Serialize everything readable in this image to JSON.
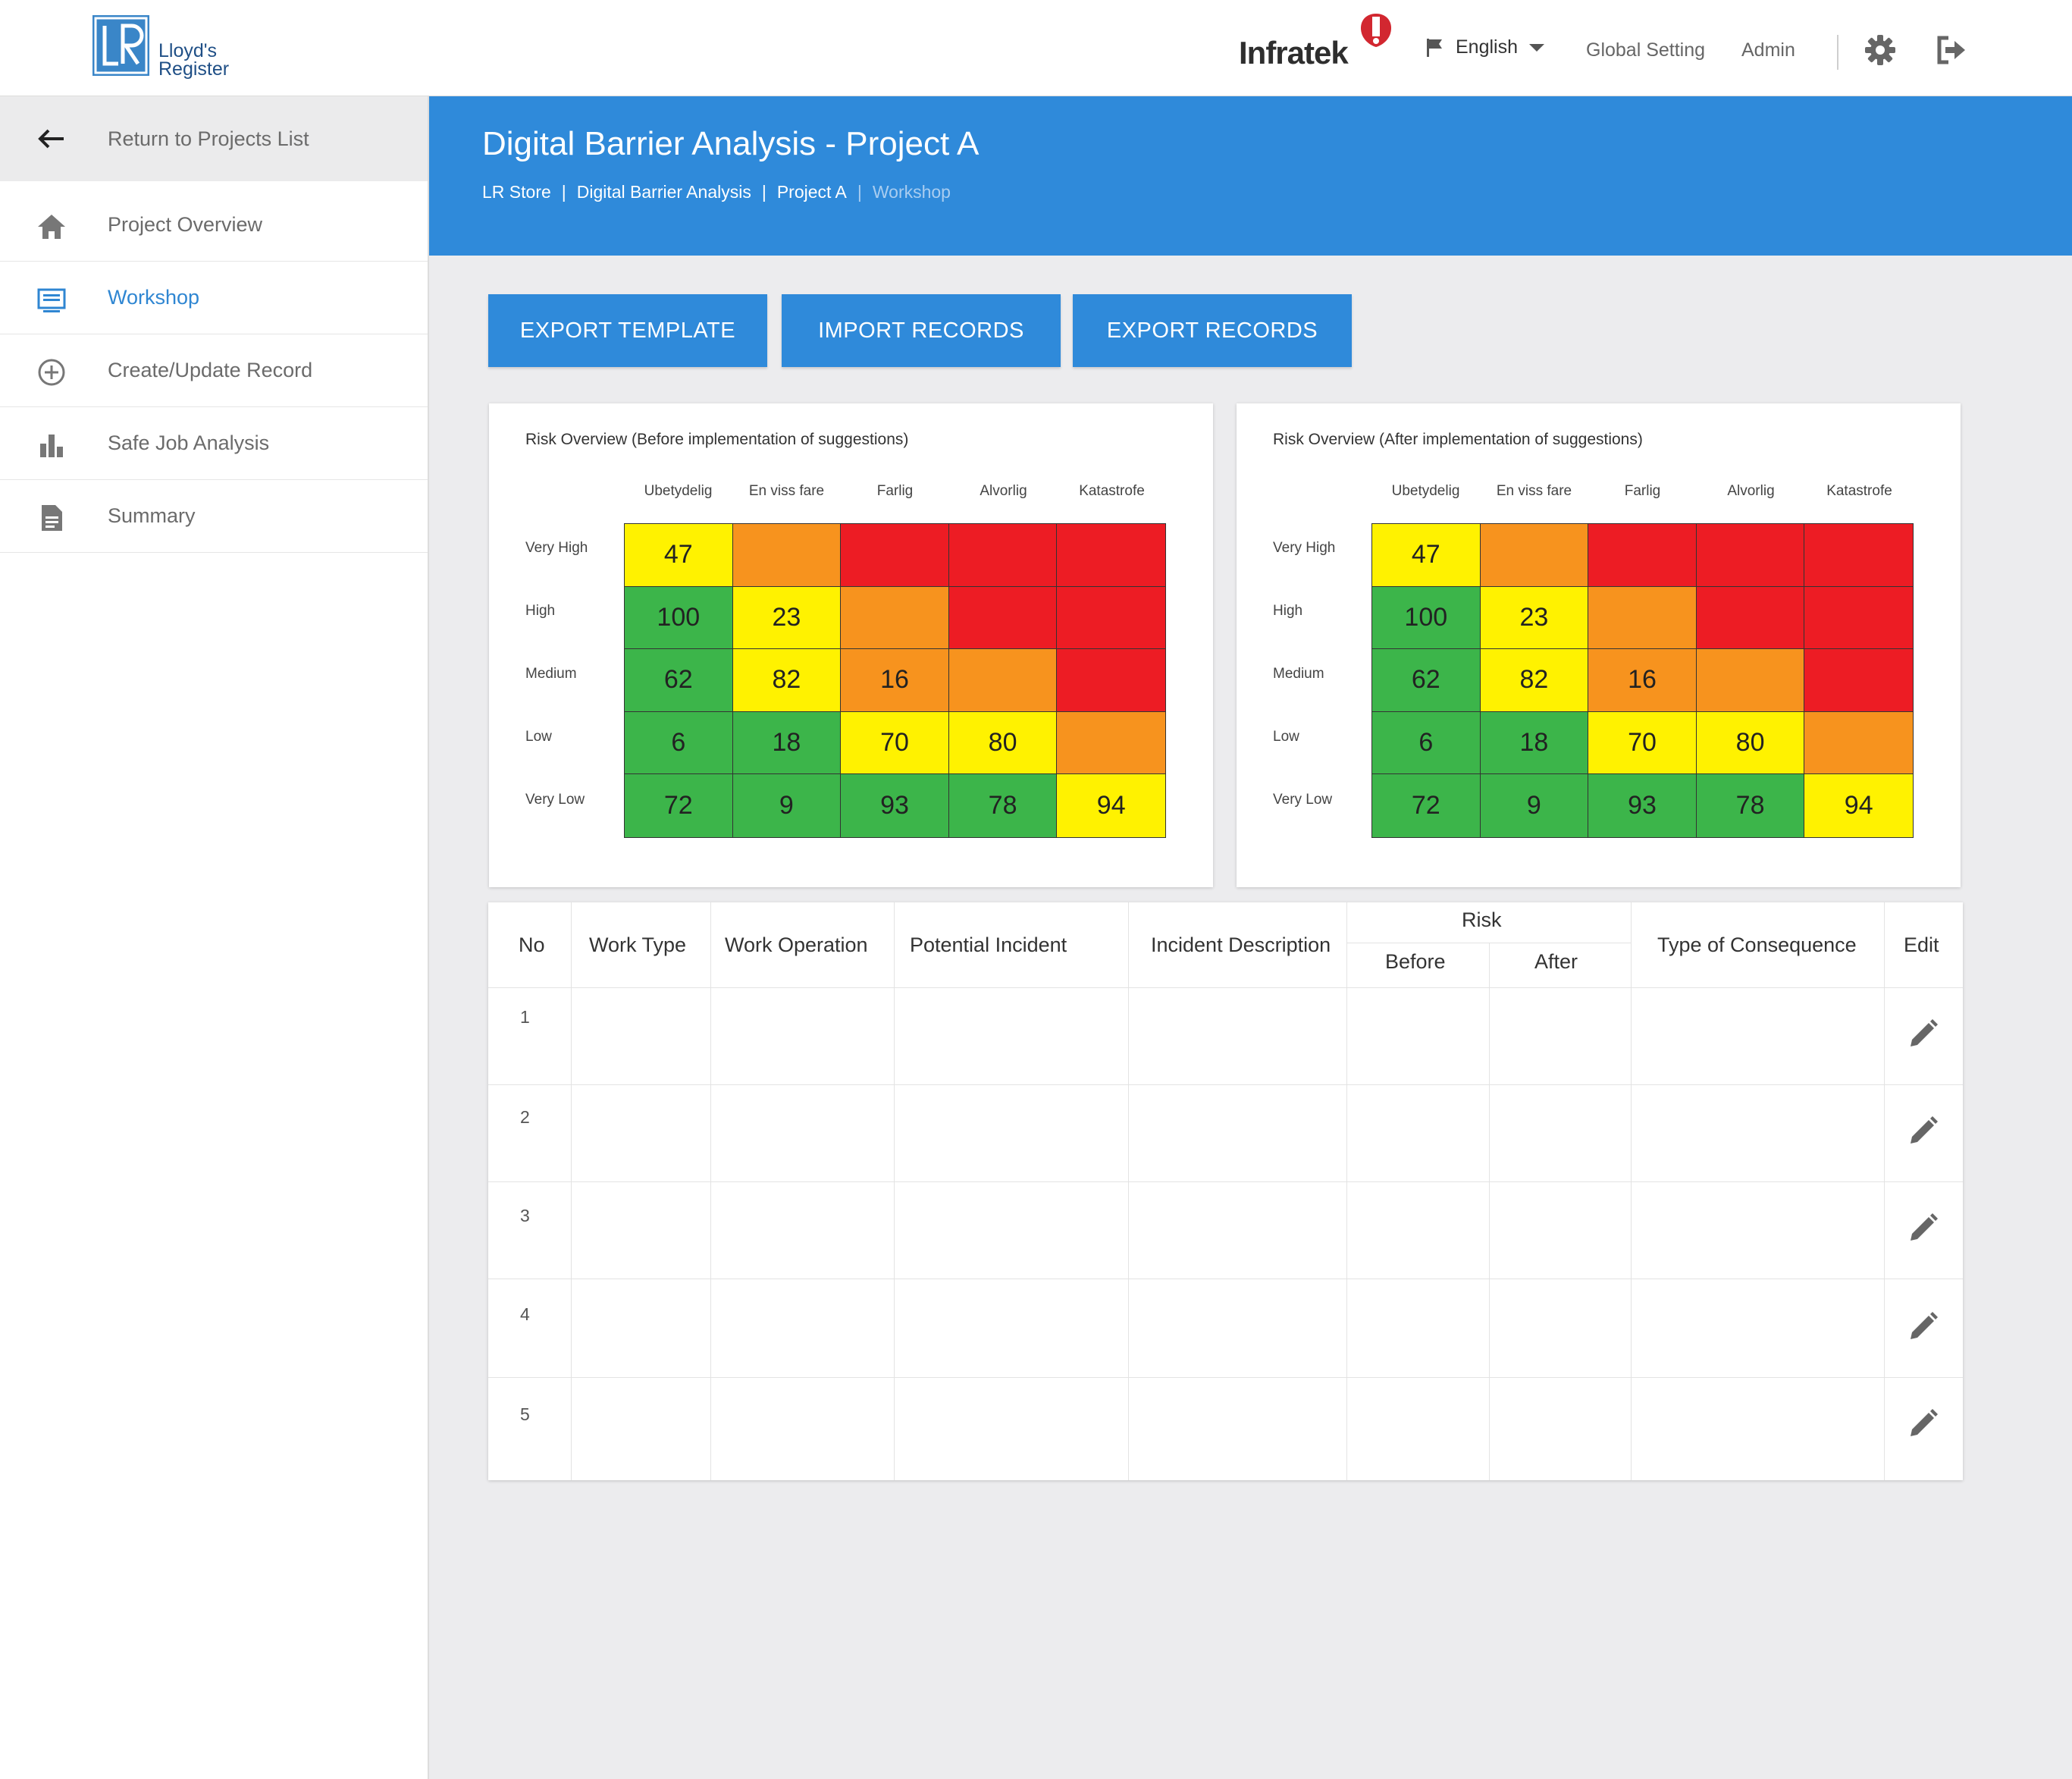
{
  "topbar": {
    "brand_line1": "Lloyd's",
    "brand_line2": "Register",
    "brand_logo_letters": "LR",
    "partner_brand": "Infratek",
    "language": "English",
    "global_setting": "Global Setting",
    "admin": "Admin",
    "icons": [
      "flag-icon",
      "chevron-down-icon",
      "gear-icon",
      "logout-icon"
    ]
  },
  "sidebar": {
    "return_label": "Return to Projects List",
    "items": [
      {
        "label": "Project Overview",
        "icon": "home-icon"
      },
      {
        "label": "Workshop",
        "icon": "monitor-icon",
        "active": true
      },
      {
        "label": "Create/Update Record",
        "icon": "plus-circle-icon"
      },
      {
        "label": "Safe Job Analysis",
        "icon": "bar-chart-icon"
      },
      {
        "label": "Summary",
        "icon": "document-icon"
      }
    ]
  },
  "header": {
    "title": "Digital Barrier Analysis - Project A",
    "breadcrumb": [
      "LR Store",
      "Digital Barrier Analysis",
      "Project  A",
      "Workshop"
    ]
  },
  "actions": {
    "export_template": "EXPORT TEMPLATE",
    "import_records": "IMPORT RECORDS",
    "export_records": "EXPORT RECORDS"
  },
  "risk": {
    "columns": [
      "Ubetydelig",
      "En viss fare",
      "Farlig",
      "Alvorlig",
      "Katastrofe"
    ],
    "rows": [
      "Very High",
      "High",
      "Medium",
      "Low",
      "Very Low"
    ],
    "colors": {
      "green": "#3cb54a",
      "yellow": "#fff200",
      "orange": "#f7931e",
      "red": "#ed1c24"
    },
    "before": {
      "title": "Risk Overview (Before implementation of suggestions)",
      "values": [
        [
          "47",
          "",
          "",
          "",
          ""
        ],
        [
          "100",
          "23",
          "",
          "",
          ""
        ],
        [
          "62",
          "82",
          "16",
          "",
          ""
        ],
        [
          "6",
          "18",
          "70",
          "80",
          ""
        ],
        [
          "72",
          "9",
          "93",
          "78",
          "94"
        ]
      ]
    },
    "after": {
      "title": "Risk Overview (After implementation of suggestions)",
      "values": [
        [
          "47",
          "",
          "",
          "",
          ""
        ],
        [
          "100",
          "23",
          "",
          "",
          ""
        ],
        [
          "62",
          "82",
          "16",
          "",
          ""
        ],
        [
          "6",
          "18",
          "70",
          "80",
          ""
        ],
        [
          "72",
          "9",
          "93",
          "78",
          "94"
        ]
      ]
    }
  },
  "table": {
    "headers": {
      "no": "No",
      "work_type": "Work Type",
      "work_operation": "Work Operation",
      "potential_incident": "Potential Incident",
      "incident_description": "Incident Description",
      "risk": "Risk",
      "before": "Before",
      "after": "After",
      "type_of_consequence": "Type of Consequence",
      "edit": "Edit"
    },
    "rows": [
      "1",
      "2",
      "3",
      "4",
      "5"
    ]
  }
}
